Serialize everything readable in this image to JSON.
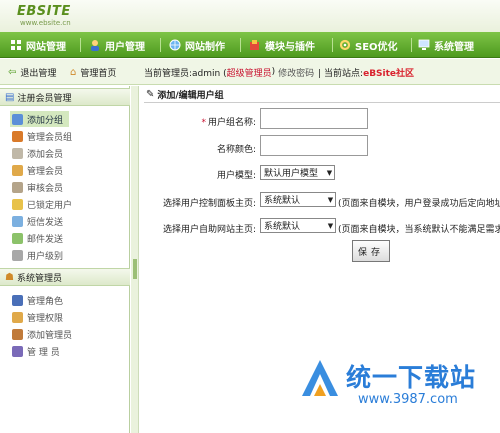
{
  "logo": {
    "text": "EBSITE",
    "sub": "www.ebsite.cn"
  },
  "nav": [
    {
      "label": "网站管理",
      "icon": "grid-icon"
    },
    {
      "label": "用户管理",
      "icon": "user-icon"
    },
    {
      "label": "网站制作",
      "icon": "globe-icon"
    },
    {
      "label": "模块与插件",
      "icon": "puzzle-icon"
    },
    {
      "label": "SEO优化",
      "icon": "gear-icon"
    },
    {
      "label": "系统管理",
      "icon": "monitor-icon"
    }
  ],
  "bar2": {
    "exit": "退出管理",
    "home": "管理首页",
    "admin_prefix": "当前管理员:admin (",
    "admin_role": "超级管理员",
    "admin_suffix": ")",
    "change_pwd": "修改密码",
    "site_prefix": "| 当前站点:",
    "site_name": "eBSite社区"
  },
  "sidebar": {
    "group1": "注册会员管理",
    "items1": [
      "添加分组",
      "管理会员组",
      "添加会员",
      "管理会员",
      "审核会员",
      "已锁定用户",
      "短信发送",
      "邮件发送",
      "用户级别"
    ],
    "group2": "系统管理员",
    "items2": [
      "管理角色",
      "管理权限",
      "添加管理员",
      "管 理 员"
    ]
  },
  "form": {
    "title": "添加/编辑用户组",
    "name_label": "用户组名称:",
    "color_label": "名称颜色:",
    "model_label": "用户模型:",
    "model_value": "默认用户模型",
    "ctrl_label": "选择用户控制面板主页:",
    "ctrl_value": "系统默认",
    "ctrl_note": "(页面来自模块，用户登录成功后定向地址,",
    "self_label": "选择用户自助网站主页:",
    "self_value": "系统默认",
    "self_note": "(页面来自模块，当系统默认不能满足需求时",
    "save": "保存"
  },
  "watermark": {
    "main": "统一下载站",
    "sub": "www.3987.com"
  },
  "colors": {
    "nav_green": "#5aa628",
    "accent_red": "#c8102e",
    "watermark_blue": "#2a7dd8"
  }
}
